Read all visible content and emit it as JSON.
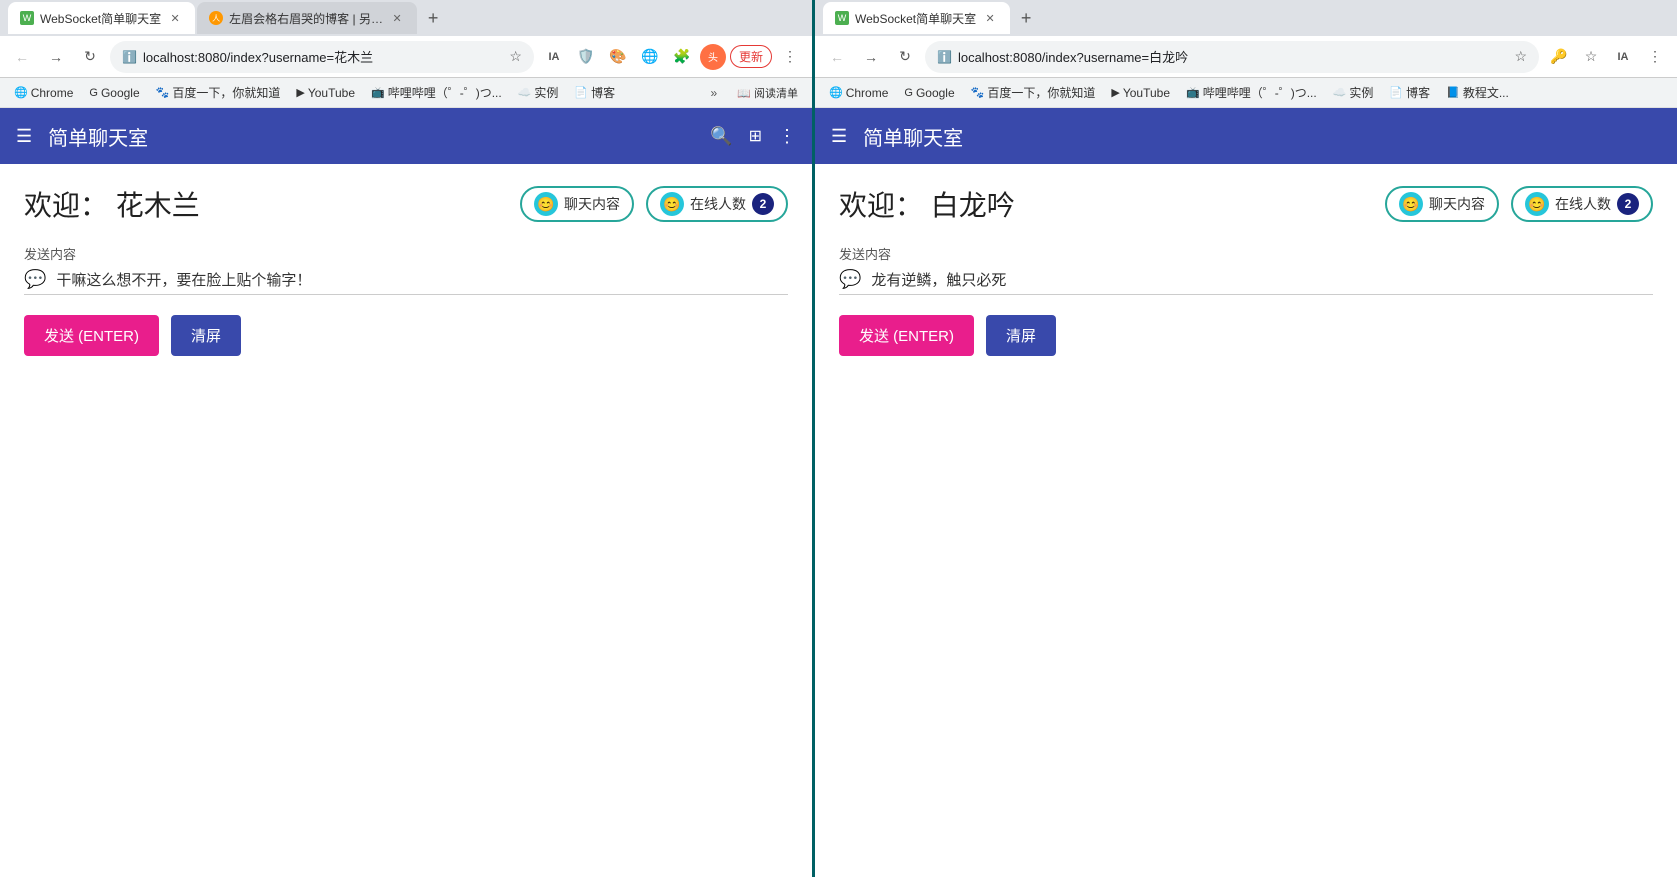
{
  "left": {
    "tab1": {
      "title": "WebSocket简单聊天室",
      "active": true
    },
    "tab2": {
      "title": "左眉会格右眉哭的博客 | 另一个...",
      "active": false
    },
    "url": "localhost:8080/index?username=花木兰",
    "bookmarks": {
      "chrome": "Chrome",
      "google": "Google",
      "baidu": "百度一下，你就知道",
      "youtube": "YouTube",
      "moe": "哔哩哔哩（゜-゜)つ...",
      "cloud": "实例",
      "blog": "博客"
    },
    "app": {
      "title": "简单聊天室",
      "welcome_label": "欢迎：",
      "username": "花木兰",
      "chat_tab": "聊天内容",
      "online_tab": "在线人数",
      "online_count": "2",
      "message_label": "发送内容",
      "message_value": "干嘛这么想不开，要在脸上贴个输字！",
      "send_button": "发送 (ENTER)",
      "clear_button": "清屏"
    }
  },
  "right": {
    "tab1": {
      "title": "WebSocket简单聊天室",
      "active": true
    },
    "url": "localhost:8080/index?username=白龙吟",
    "bookmarks": {
      "chrome": "Chrome",
      "google": "Google",
      "baidu": "百度一下，你就知道",
      "youtube": "YouTube",
      "moe": "哔哩哔哩（゜-゜)つ...",
      "cloud": "实例",
      "blog": "博客",
      "tutorial": "教程文..."
    },
    "app": {
      "title": "简单聊天室",
      "welcome_label": "欢迎：",
      "username": "白龙吟",
      "chat_tab": "聊天内容",
      "online_tab": "在线人数",
      "online_count": "2",
      "message_label": "发送内容",
      "message_value": "龙有逆鳞，触只必死",
      "send_button": "发送 (ENTER)",
      "clear_button": "清屏"
    }
  },
  "icons": {
    "menu": "☰",
    "search": "🔍",
    "exit": "⬚",
    "more": "⋮",
    "lock": "🔒",
    "star": "☆",
    "back": "←",
    "forward": "→",
    "reload": "↻",
    "chat_bubble": "💬",
    "smiley": "😊",
    "message_icon": "💬",
    "new_tab": "+"
  }
}
